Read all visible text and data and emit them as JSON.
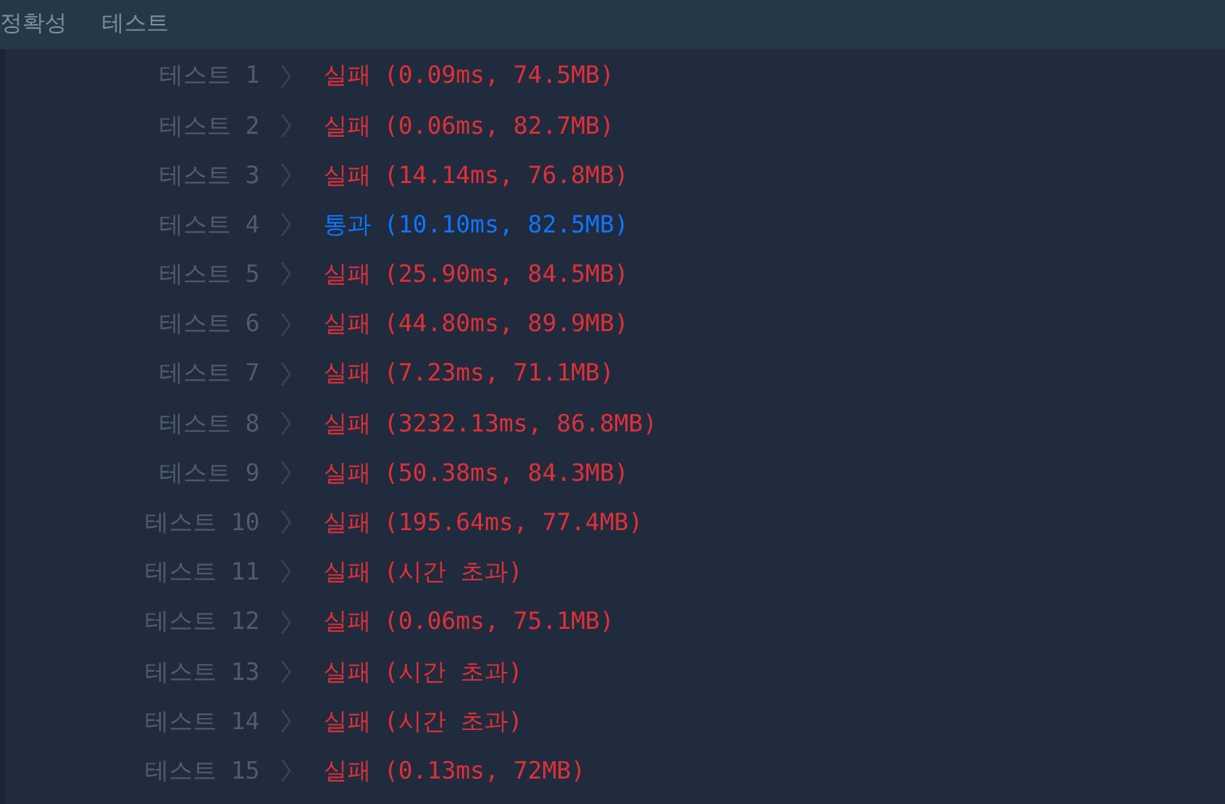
{
  "header": {
    "tabs": [
      "정확성",
      "테스트"
    ]
  },
  "rows": [
    {
      "label": "테스트 1",
      "passed": false,
      "status": "실패",
      "detail": "(0.09ms, 74.5MB)"
    },
    {
      "label": "테스트 2",
      "passed": false,
      "status": "실패",
      "detail": "(0.06ms, 82.7MB)"
    },
    {
      "label": "테스트 3",
      "passed": false,
      "status": "실패",
      "detail": "(14.14ms, 76.8MB)"
    },
    {
      "label": "테스트 4",
      "passed": true,
      "status": "통과",
      "detail": "(10.10ms, 82.5MB)"
    },
    {
      "label": "테스트 5",
      "passed": false,
      "status": "실패",
      "detail": "(25.90ms, 84.5MB)"
    },
    {
      "label": "테스트 6",
      "passed": false,
      "status": "실패",
      "detail": "(44.80ms, 89.9MB)"
    },
    {
      "label": "테스트 7",
      "passed": false,
      "status": "실패",
      "detail": "(7.23ms, 71.1MB)"
    },
    {
      "label": "테스트 8",
      "passed": false,
      "status": "실패",
      "detail": "(3232.13ms, 86.8MB)"
    },
    {
      "label": "테스트 9",
      "passed": false,
      "status": "실패",
      "detail": "(50.38ms, 84.3MB)"
    },
    {
      "label": "테스트 10",
      "passed": false,
      "status": "실패",
      "detail": "(195.64ms, 77.4MB)"
    },
    {
      "label": "테스트 11",
      "passed": false,
      "status": "실패",
      "detail": "(시간 초과)"
    },
    {
      "label": "테스트 12",
      "passed": false,
      "status": "실패",
      "detail": "(0.06ms, 75.1MB)"
    },
    {
      "label": "테스트 13",
      "passed": false,
      "status": "실패",
      "detail": "(시간 초과)"
    },
    {
      "label": "테스트 14",
      "passed": false,
      "status": "실패",
      "detail": "(시간 초과)"
    },
    {
      "label": "테스트 15",
      "passed": false,
      "status": "실패",
      "detail": "(0.13ms, 72MB)"
    }
  ]
}
